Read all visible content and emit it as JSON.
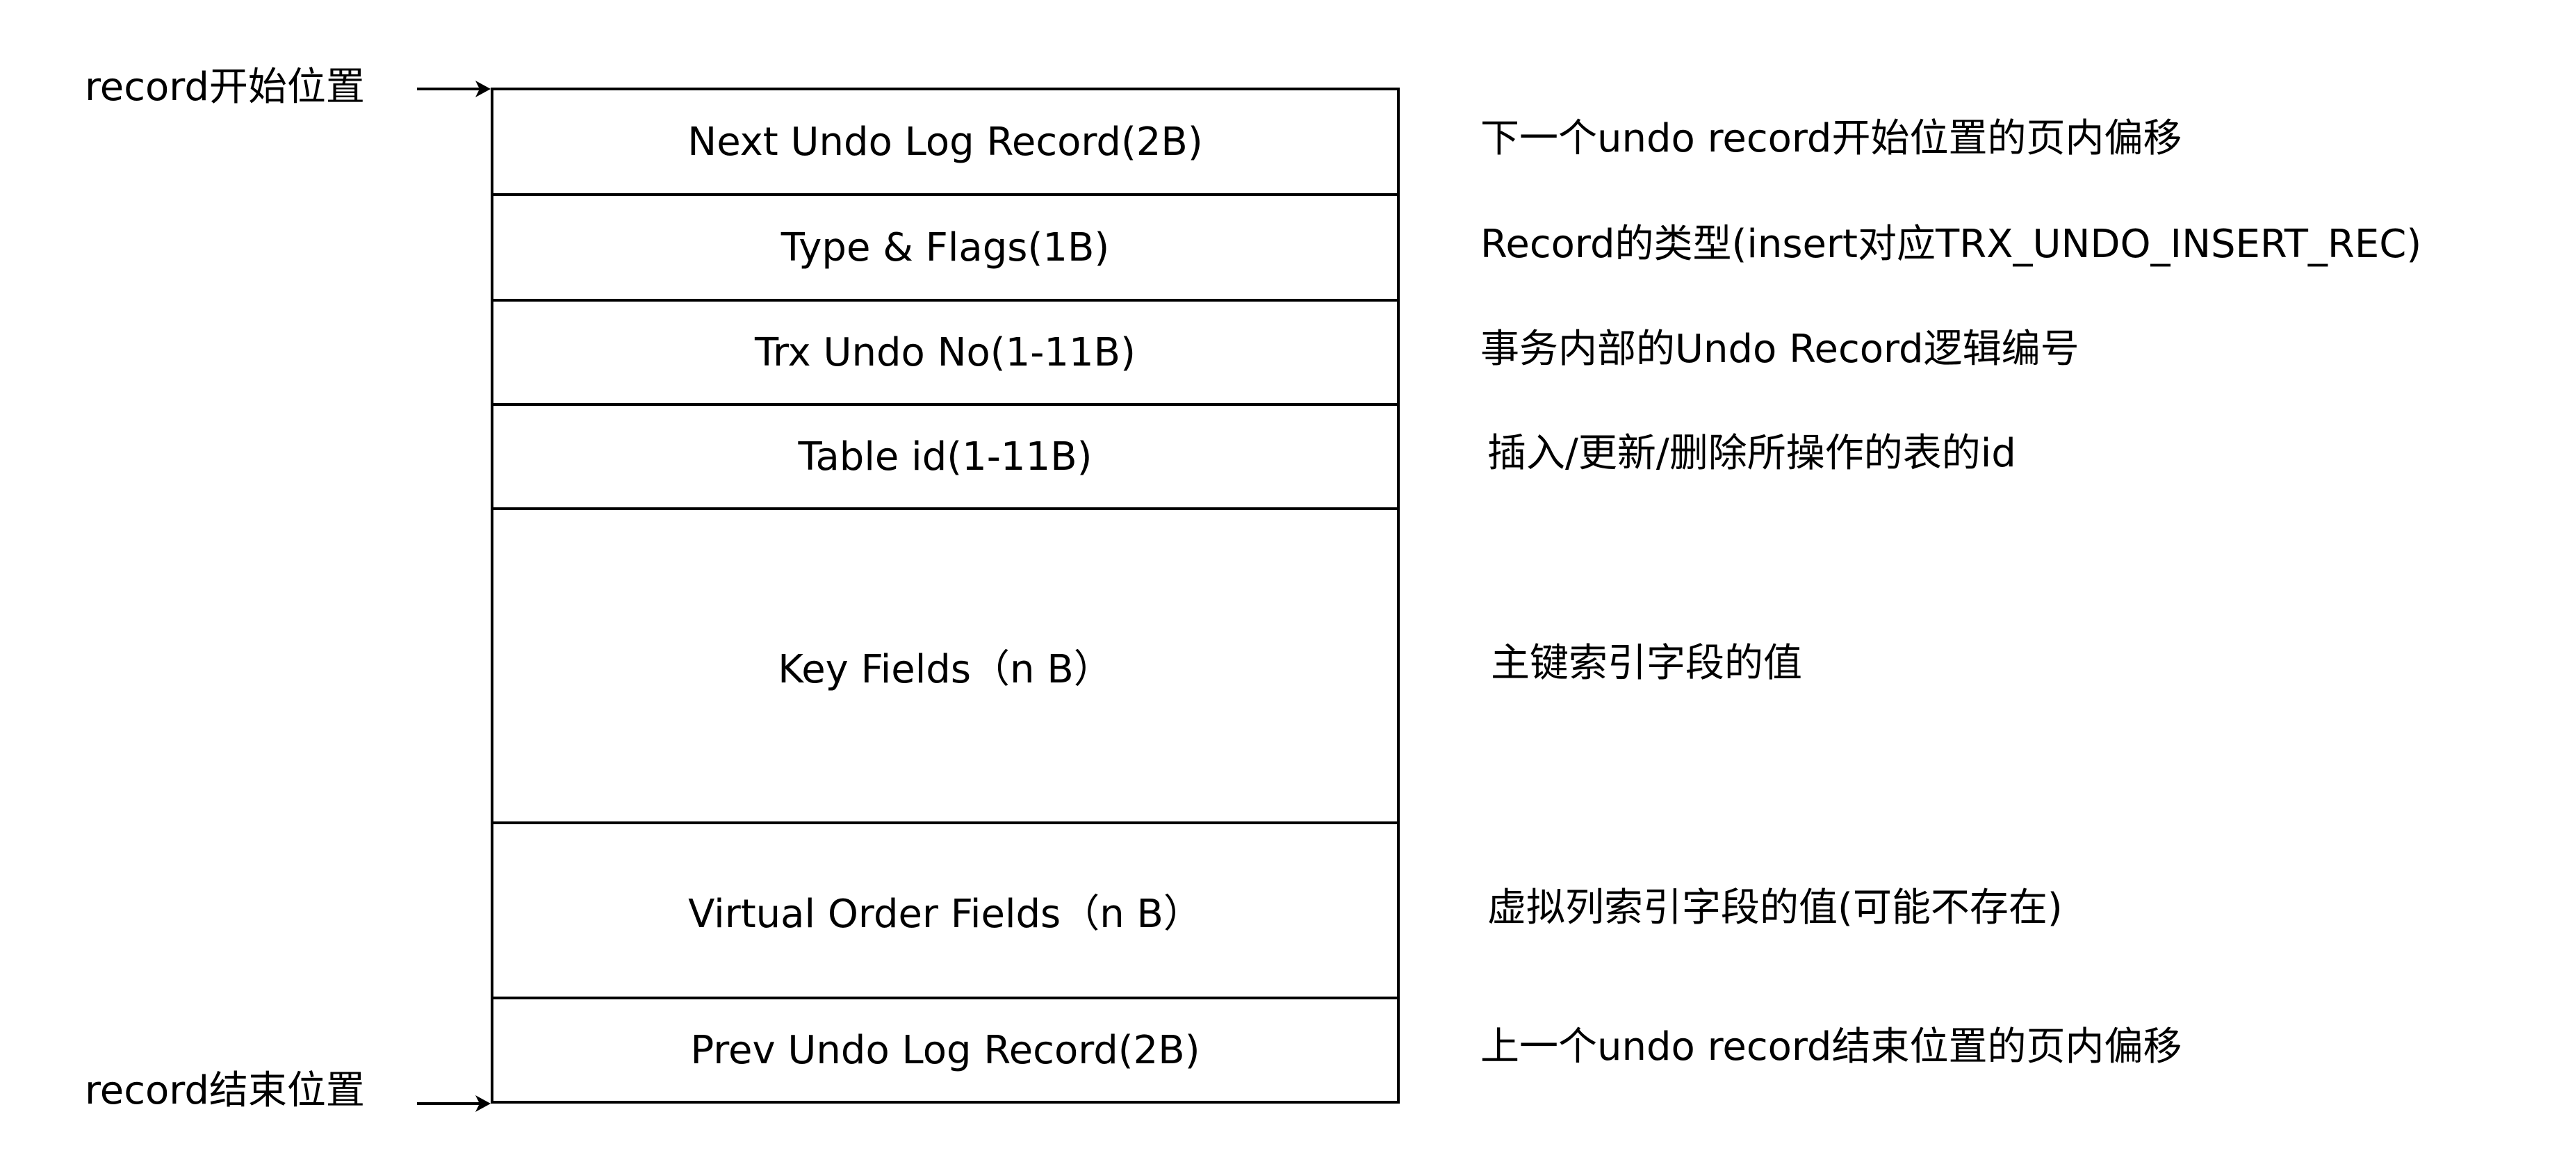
{
  "labels": {
    "record_start": "record开始位置",
    "record_end": "record结束位置"
  },
  "fields": [
    {
      "name": "Next Undo Log Record(2B)",
      "desc": "下一个undo record开始位置的页内偏移"
    },
    {
      "name": "Type & Flags(1B)",
      "desc": "Record的类型(insert对应TRX_UNDO_INSERT_REC)"
    },
    {
      "name": "Trx Undo No(1-11B)",
      "desc": "事务内部的Undo Record逻辑编号"
    },
    {
      "name": "Table id(1-11B)",
      "desc": "插入/更新/删除所操作的表的id"
    },
    {
      "name": "Key Fields（n B）",
      "desc": "主键索引字段的值"
    },
    {
      "name": "Virtual Order Fields（n B）",
      "desc": "虚拟列索引字段的值(可能不存在)"
    },
    {
      "name": "Prev Undo Log Record(2B)",
      "desc": "上一个undo record结束位置的页内偏移"
    }
  ]
}
